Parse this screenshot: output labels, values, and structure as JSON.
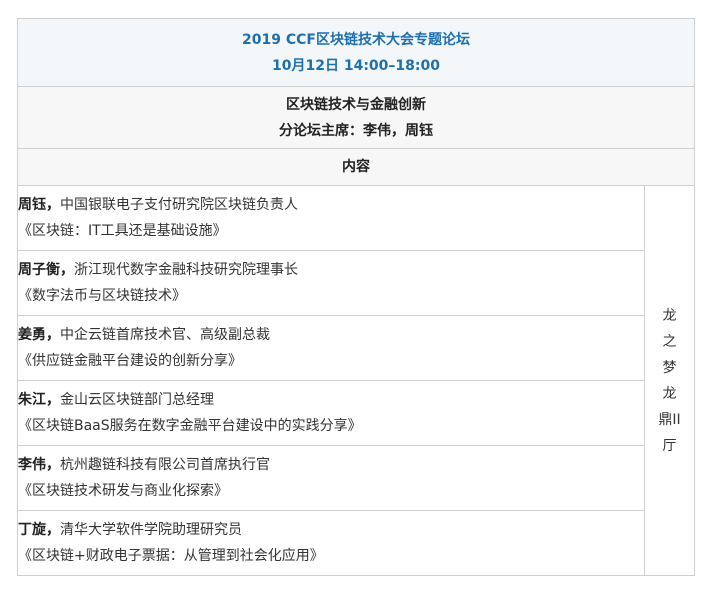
{
  "header": {
    "title": "2019 CCF区块链技术大会专题论坛",
    "time": "10月12日 14:00–18:00"
  },
  "forum": {
    "name": "区块链技术与金融创新",
    "chairs": "分论坛主席：李伟，周钰"
  },
  "content_label": "内容",
  "venue": [
    "龙",
    "之",
    "梦",
    "龙",
    "鼎II",
    "厅"
  ],
  "talks": [
    {
      "speaker": "周钰，",
      "affiliation": "中国银联电子支付研究院区块链负责人",
      "topic": "《区块链：IT工具还是基础设施》"
    },
    {
      "speaker": "周子衡，",
      "affiliation": "浙江现代数字金融科技研究院理事长",
      "topic": "《数字法币与区块链技术》"
    },
    {
      "speaker": "姜勇，",
      "affiliation": "中企云链首席技术官、高级副总裁",
      "topic": "《供应链金融平台建设的创新分享》"
    },
    {
      "speaker": "朱江，",
      "affiliation": "金山云区块链部门总经理",
      "topic": "《区块链BaaS服务在数字金融平台建设中的实践分享》"
    },
    {
      "speaker": "李伟，",
      "affiliation": "杭州趣链科技有限公司首席执行官",
      "topic": "《区块链技术研发与商业化探索》"
    },
    {
      "speaker": "丁旋，",
      "affiliation": "清华大学软件学院助理研究员",
      "topic": "《区块链+财政电子票据：从管理到社会化应用》"
    }
  ]
}
